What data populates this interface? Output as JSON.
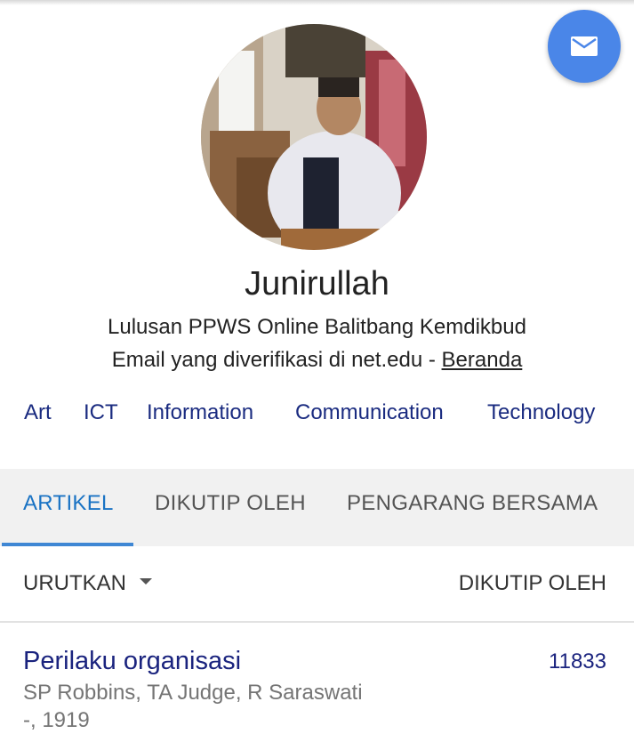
{
  "profile": {
    "name": "Junirullah",
    "affiliation": "Lulusan PPWS Online Balitbang Kemdikbud",
    "email_text": "Email yang diverifikasi di net.edu - ",
    "homepage_link": "Beranda",
    "interests": [
      "Art",
      "ICT",
      "Information",
      "Communication",
      "Technology"
    ]
  },
  "tabs": [
    {
      "label": "ARTIKEL",
      "active": true
    },
    {
      "label": "DIKUTIP OLEH",
      "active": false
    },
    {
      "label": "PENGARANG BERSAMA",
      "active": false
    }
  ],
  "sort": {
    "label": "URUTKAN",
    "right_label": "DIKUTIP OLEH"
  },
  "articles": [
    {
      "title": "Perilaku organisasi",
      "authors": "SP Robbins, TA Judge, R Saraswati",
      "venue": "-, 1919",
      "cited_by": "11833"
    }
  ],
  "icons": {
    "fab": "mail-icon",
    "sort": "caret-down-icon"
  },
  "colors": {
    "accent": "#4a86e8",
    "link": "#1a237e",
    "tab_active": "#1a73c4"
  }
}
